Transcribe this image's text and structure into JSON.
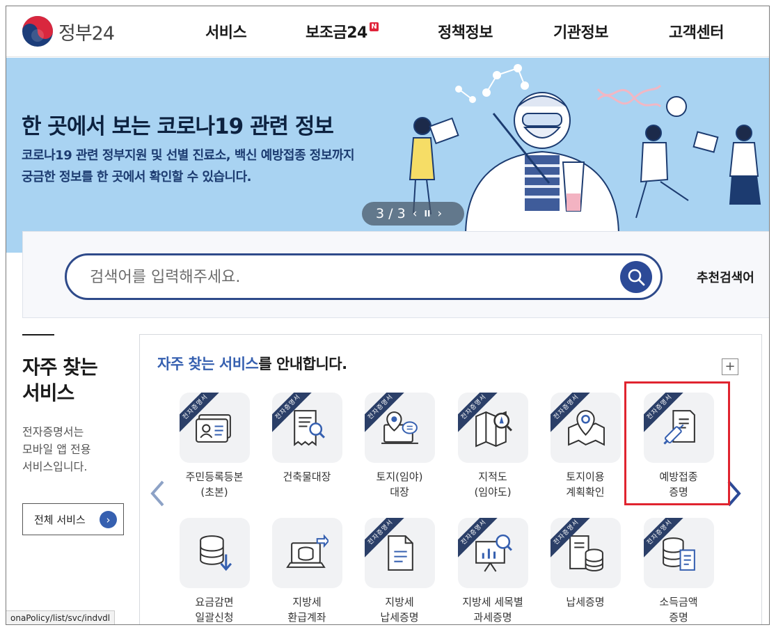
{
  "header": {
    "logo_text": "정부24",
    "nav": [
      {
        "label": "서비스",
        "badge": ""
      },
      {
        "label": "보조금24",
        "badge": "N"
      },
      {
        "label": "정책정보",
        "badge": ""
      },
      {
        "label": "기관정보",
        "badge": ""
      },
      {
        "label": "고객센터",
        "badge": ""
      }
    ]
  },
  "banner": {
    "title": "한 곳에서 보는 코로나19 관련 정보",
    "desc_line1": "코로나19 관련 정부지원 및 선별 진료소, 백신 예방접종 정보까지",
    "desc_line2": "궁금한 정보를 한 곳에서 확인할 수 있습니다.",
    "slider_count": "3 / 3",
    "prev_icon": "‹",
    "pause_icon": "II",
    "next_icon": "›",
    "background_color": "#a9d3f2"
  },
  "search": {
    "placeholder": "검색어를 입력해주세요.",
    "value": "",
    "recommend_label": "추천검색어",
    "accent_color": "#2e4a8a"
  },
  "left_panel": {
    "title_line1": "자주 찾는",
    "title_line2": "서비스",
    "desc_line1": "전자증명서는",
    "desc_line2": "모바일 앱 전용",
    "desc_line3": "서비스입니다.",
    "all_services_label": "전체 서비스",
    "all_services_icon": "›"
  },
  "services": {
    "heading_highlight": "자주 찾는 서비스",
    "heading_rest": "를 안내합니다.",
    "plus_label": "+",
    "arrow_left": "〈",
    "arrow_right": "〉",
    "ribbon_text": "전자증명서",
    "highlight_color": "#e0242f",
    "items": [
      {
        "line1": "주민등록등본",
        "line2": "(초본)",
        "icon": "id-card-icon",
        "ribbon": true
      },
      {
        "line1": "건축물대장",
        "line2": "",
        "icon": "document-search-icon",
        "ribbon": true
      },
      {
        "line1": "토지(임야)",
        "line2": "대장",
        "icon": "location-laptop-icon",
        "ribbon": true
      },
      {
        "line1": "지적도",
        "line2": "(임야도)",
        "icon": "map-search-icon",
        "ribbon": true
      },
      {
        "line1": "토지이용",
        "line2": "계획확인",
        "icon": "map-pin-icon",
        "ribbon": true
      },
      {
        "line1": "예방접종",
        "line2": "증명",
        "icon": "syringe-document-icon",
        "ribbon": true
      },
      {
        "line1": "요금감면",
        "line2": "일괄신청",
        "icon": "coins-download-icon",
        "ribbon": false
      },
      {
        "line1": "지방세",
        "line2": "환급계좌",
        "icon": "laptop-refund-icon",
        "ribbon": false
      },
      {
        "line1": "지방세",
        "line2": "납세증명",
        "icon": "document-icon",
        "ribbon": true
      },
      {
        "line1": "지방세 세목별",
        "line2": "과세증명",
        "icon": "chart-board-icon",
        "ribbon": true
      },
      {
        "line1": "납세증명",
        "line2": "",
        "icon": "document-coins-icon",
        "ribbon": true
      },
      {
        "line1": "소득금액",
        "line2": "증명",
        "icon": "coins-document-icon",
        "ribbon": true
      }
    ]
  },
  "status_bar": {
    "url": "onaPolicy/list/svc/indvdl"
  }
}
